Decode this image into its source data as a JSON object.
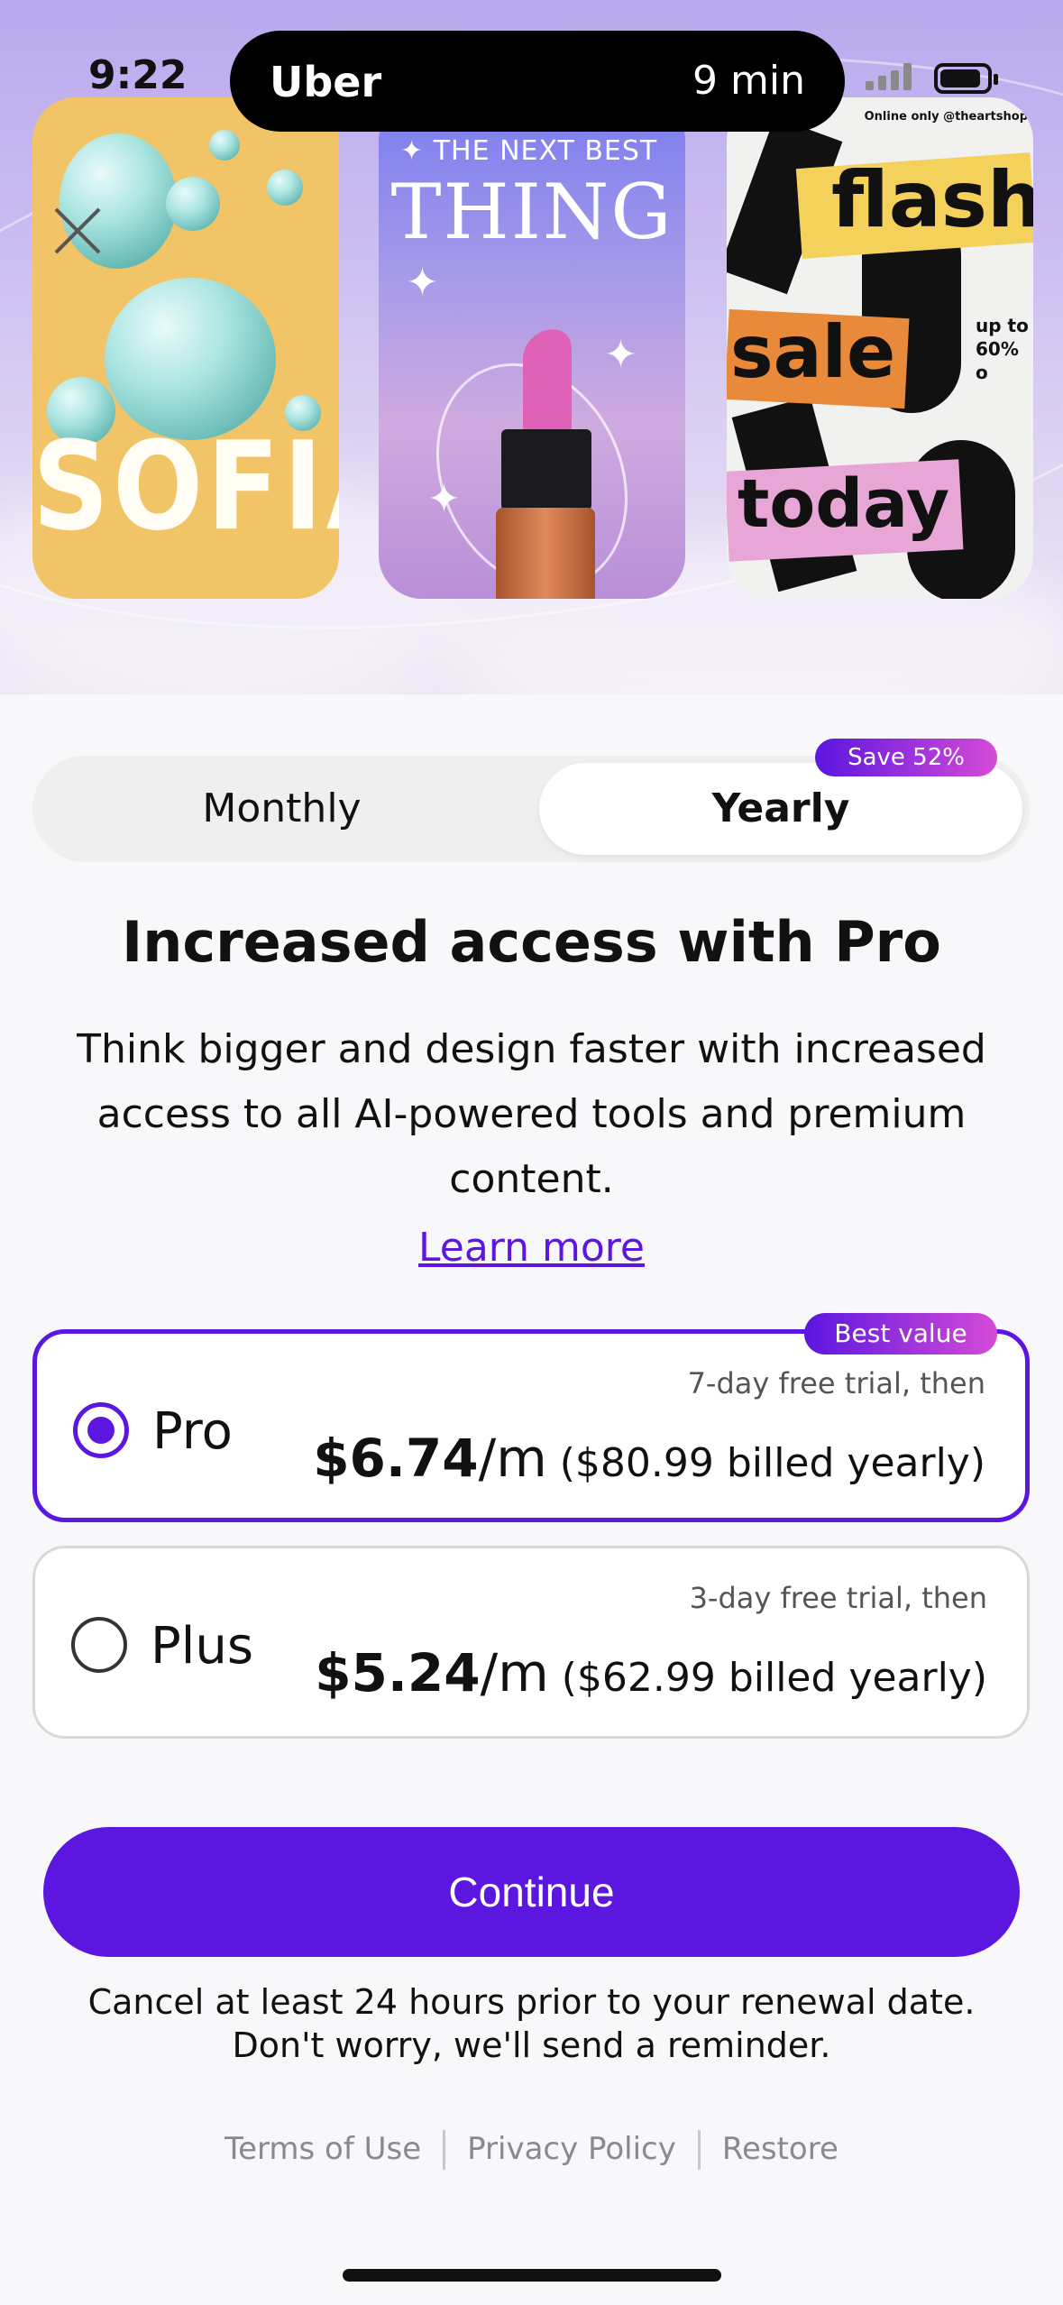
{
  "status_bar": {
    "time": "9:22"
  },
  "live_activity": {
    "app": "Uber",
    "eta": "9 min"
  },
  "hero": {
    "card1": {
      "text": "SOFIA"
    },
    "card2": {
      "top": "THE NEXT BEST",
      "big": "THING"
    },
    "card3": {
      "credit": "Online only @theartshop",
      "w1": "flash",
      "w2": "sale",
      "w3": "today",
      "side": "up to 60% o"
    }
  },
  "toggle": {
    "monthly": "Monthly",
    "yearly": "Yearly",
    "save_badge": "Save 52%"
  },
  "headline": "Increased access with Pro",
  "description": "Think bigger and design faster with increased access to all AI-powered tools and premium content.",
  "learn_more": "Learn more",
  "plans": [
    {
      "name": "Pro",
      "badge": "Best value",
      "trial": "7-day free trial, then",
      "price": "$6.74",
      "period": "/m",
      "billed": "($80.99 billed yearly)",
      "selected": true
    },
    {
      "name": "Plus",
      "trial": "3-day free trial, then",
      "price": "$5.24",
      "period": "/m",
      "billed": "($62.99 billed yearly)",
      "selected": false
    }
  ],
  "cta": "Continue",
  "note_line1": "Cancel at least 24 hours prior to your renewal date.",
  "note_line2": "Don't worry, we'll send a reminder.",
  "footer": {
    "terms": "Terms of Use",
    "privacy": "Privacy Policy",
    "restore": "Restore"
  },
  "colors": {
    "accent": "#5b16e0",
    "badge_gradient_end": "#d64bd7"
  }
}
